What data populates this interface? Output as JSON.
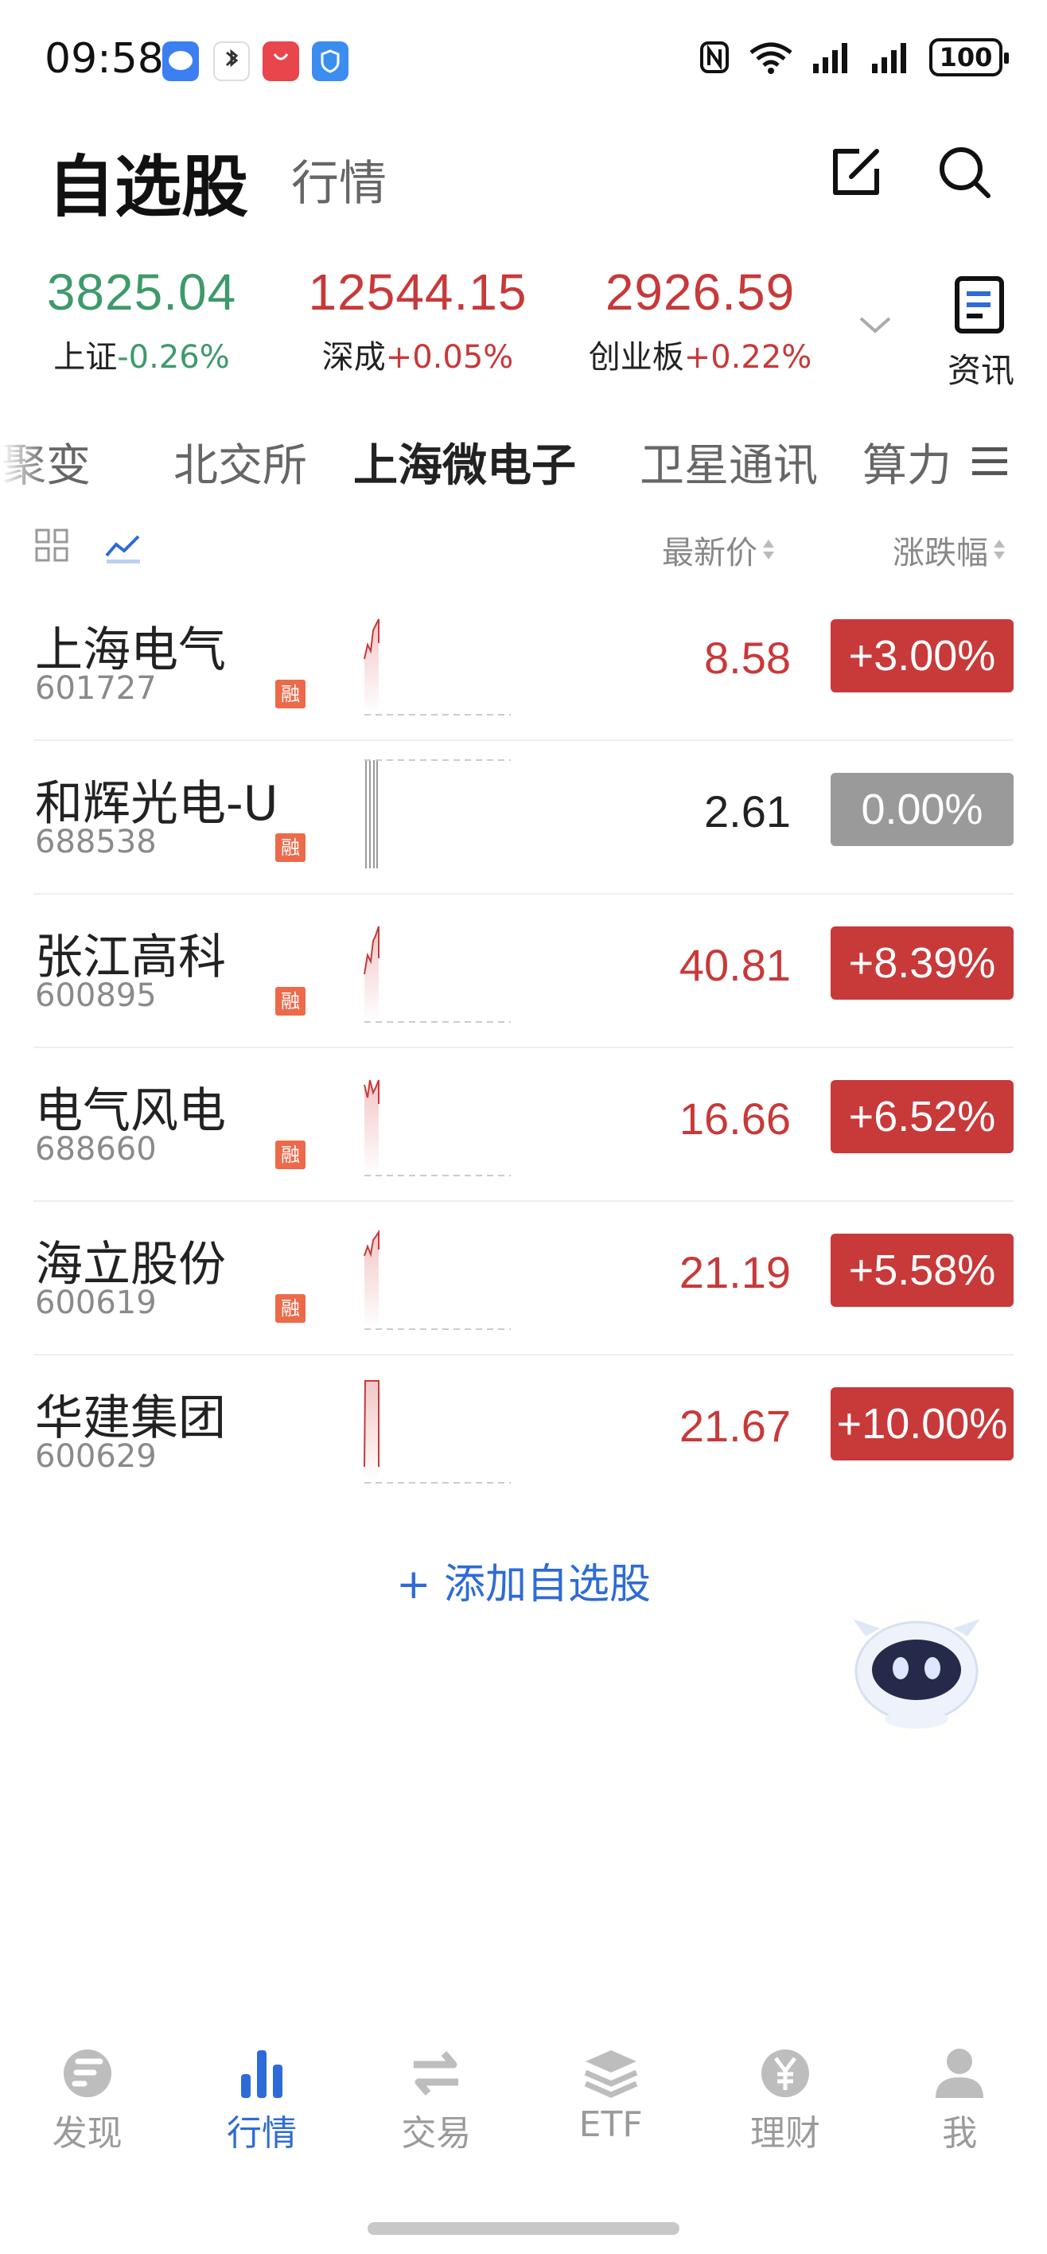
{
  "status_bar": {
    "time": "09:58",
    "battery": "100",
    "app_icons": [
      "messages-icon",
      "bluetooth-notification-icon",
      "app-gallery-icon",
      "security-shield-icon"
    ],
    "system_icons": [
      "nfc-icon",
      "wifi-icon",
      "signal-icon",
      "signal-icon"
    ]
  },
  "header": {
    "title": "自选股",
    "market_tab": "行情",
    "icons": [
      "edit-icon",
      "search-icon"
    ]
  },
  "indices": [
    {
      "name": "上证",
      "value": "3825.04",
      "change": "-0.26%",
      "trend": "down"
    },
    {
      "name": "深成",
      "value": "12544.15",
      "change": "+0.05%",
      "trend": "up"
    },
    {
      "name": "创业板",
      "value": "2926.59",
      "change": "+0.22%",
      "trend": "up"
    }
  ],
  "news_button": {
    "label": "资讯",
    "icon": "news-icon"
  },
  "category_tabs": {
    "items": [
      "聚变",
      "北交所",
      "上海微电子",
      "卫星通讯",
      "算力"
    ],
    "active_index": 2
  },
  "columns": {
    "price": "最新价",
    "change": "涨跌幅"
  },
  "stocks": [
    {
      "name": "上海电气",
      "code": "601727",
      "margin": "融",
      "price": "8.58",
      "change": "+3.00%",
      "trend": "up"
    },
    {
      "name": "和辉光电-U",
      "code": "688538",
      "margin": "融",
      "price": "2.61",
      "change": "0.00%",
      "trend": "flat"
    },
    {
      "name": "张江高科",
      "code": "600895",
      "margin": "融",
      "price": "40.81",
      "change": "+8.39%",
      "trend": "up"
    },
    {
      "name": "电气风电",
      "code": "688660",
      "margin": "融",
      "price": "16.66",
      "change": "+6.52%",
      "trend": "up"
    },
    {
      "name": "海立股份",
      "code": "600619",
      "margin": "融",
      "price": "21.19",
      "change": "+5.58%",
      "trend": "up"
    },
    {
      "name": "华建集团",
      "code": "600629",
      "margin": "",
      "price": "21.67",
      "change": "+10.00%",
      "trend": "up"
    }
  ],
  "add_stock": "+ 添加自选股",
  "bottom_nav": {
    "items": [
      {
        "label": "发现",
        "icon": "discover-icon"
      },
      {
        "label": "行情",
        "icon": "market-chart-icon"
      },
      {
        "label": "交易",
        "icon": "trade-arrows-icon"
      },
      {
        "label": "ETF",
        "icon": "etf-layers-icon"
      },
      {
        "label": "理财",
        "icon": "wealth-yuan-icon"
      },
      {
        "label": "我",
        "icon": "profile-icon"
      }
    ],
    "active_index": 1
  },
  "colors": {
    "up": "#c8393a",
    "down": "#3d9a6b",
    "flat": "#9a9a9a",
    "accent": "#2e6bd6"
  }
}
